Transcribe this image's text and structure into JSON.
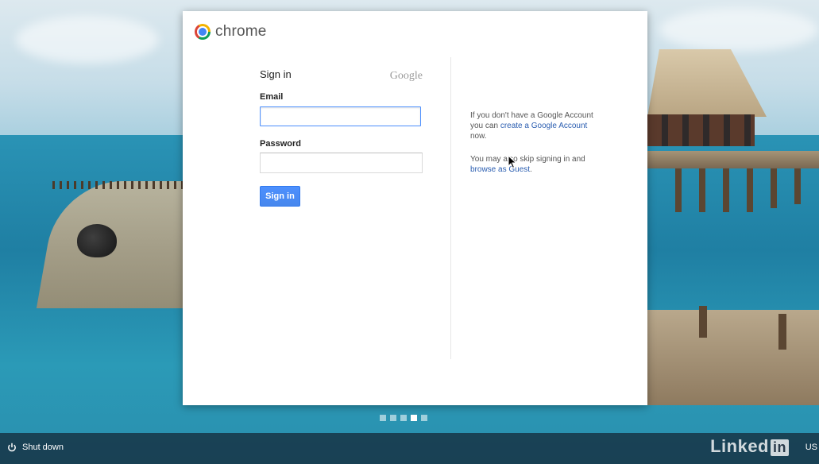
{
  "dialog": {
    "brand_name": "chrome",
    "signin_title": "Sign in",
    "google_wordmark": "Google",
    "email_label": "Email",
    "email_value": "",
    "password_label": "Password",
    "password_value": "",
    "signin_button": "Sign in"
  },
  "side_info": {
    "no_account_prefix": "If you don't have a Google Account you can ",
    "create_account_link": "create a Google Account",
    "no_account_suffix": " now.",
    "guest_prefix": "You may also skip signing in and ",
    "guest_link": "browse as Guest",
    "guest_suffix": "."
  },
  "pager": {
    "total": 5,
    "active_index": 3
  },
  "shelf": {
    "shutdown_label": "Shut down",
    "watermark": "Linked",
    "watermark_box": "in",
    "edge_text": "US"
  },
  "colors": {
    "accent_blue": "#4d90fe",
    "link_blue": "#2a5db0",
    "shelf_bg": "#142332"
  },
  "icons": {
    "brand": "chrome-logo-icon",
    "power": "power-icon",
    "cursor": "mouse-pointer-icon"
  }
}
